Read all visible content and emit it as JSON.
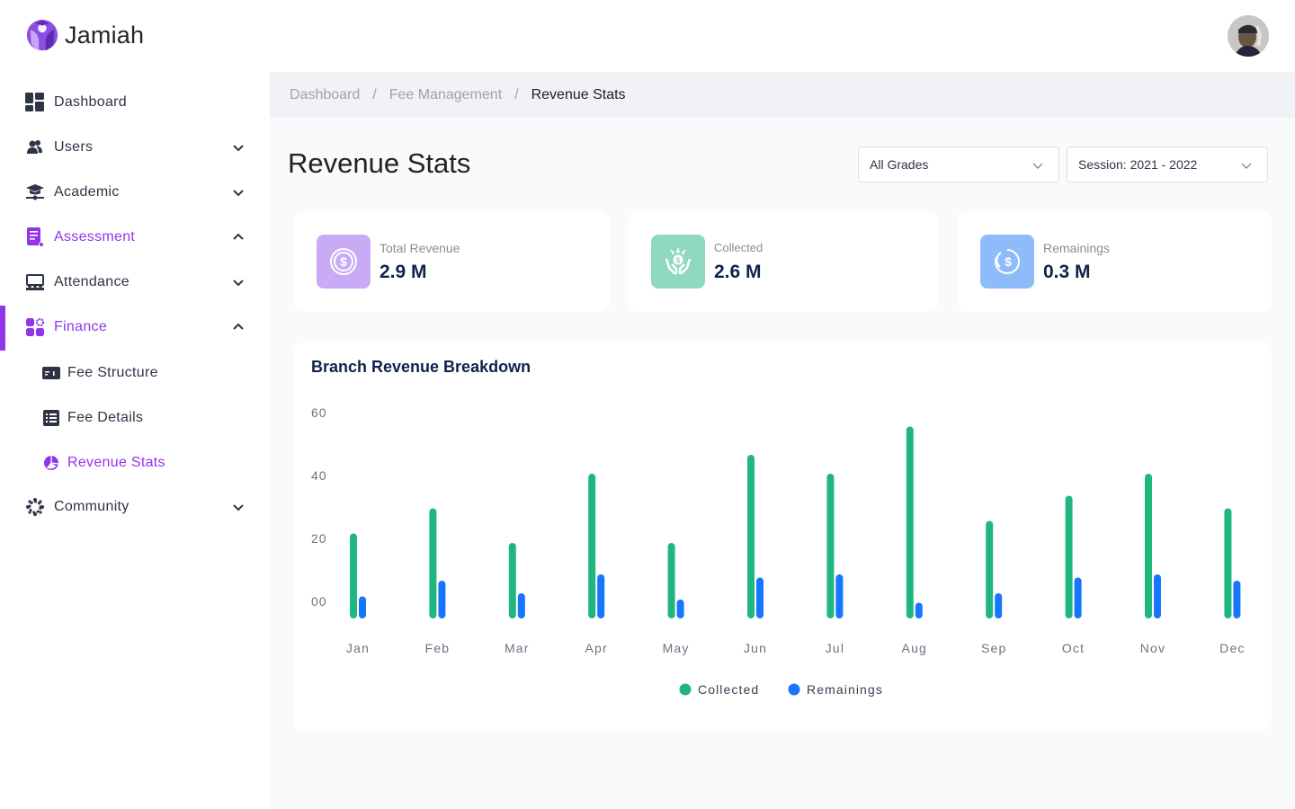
{
  "app": {
    "name": "Jamiah",
    "brand_color": "#9234ea"
  },
  "header": {
    "avatar_alt": "User avatar"
  },
  "sidebar": {
    "items": [
      {
        "label": "Dashboard",
        "icon": "dashboard-icon",
        "expandable": false,
        "active": false
      },
      {
        "label": "Users",
        "icon": "users-icon",
        "expandable": true,
        "expanded": false,
        "active": false
      },
      {
        "label": "Academic",
        "icon": "graduation-cap-icon",
        "expandable": true,
        "expanded": false,
        "active": false
      },
      {
        "label": "Assessment",
        "icon": "document-icon",
        "expandable": true,
        "expanded": true,
        "active": true
      },
      {
        "label": "Attendance",
        "icon": "attendance-icon",
        "expandable": true,
        "expanded": false,
        "active": false
      },
      {
        "label": "Finance",
        "icon": "finance-icon",
        "expandable": true,
        "expanded": true,
        "active": true,
        "children": [
          {
            "label": "Fee Structure",
            "icon": "fee-structure-icon",
            "active": false
          },
          {
            "label": "Fee Details",
            "icon": "list-icon",
            "active": false
          },
          {
            "label": "Revenue Stats",
            "icon": "pie-chart-icon",
            "active": true
          }
        ]
      },
      {
        "label": "Community",
        "icon": "community-icon",
        "expandable": true,
        "expanded": false,
        "active": false
      }
    ]
  },
  "breadcrumb": [
    "Dashboard",
    "Fee Management",
    "Revenue Stats"
  ],
  "page": {
    "title": "Revenue Stats"
  },
  "filters": {
    "grade": {
      "selected": "All Grades"
    },
    "session": {
      "selected": "Session: 2021 - 2022"
    }
  },
  "stats": [
    {
      "label": "Total Revenue",
      "value": "2.9 M",
      "icon": "dollar-coin-icon",
      "color": "#c9aaf5"
    },
    {
      "label": "Collected",
      "value": "2.6 M",
      "icon": "hands-money-icon",
      "color": "#8fd9bf"
    },
    {
      "label": "Remainings",
      "value": "0.3 M",
      "icon": "dollar-refresh-icon",
      "color": "#8ebcfb"
    }
  ],
  "chart_data": {
    "type": "bar",
    "title": "Branch Revenue Breakdown",
    "categories": [
      "Jan",
      "Feb",
      "Mar",
      "Apr",
      "May",
      "Jun",
      "Jul",
      "Aug",
      "Sep",
      "Oct",
      "Nov",
      "Dec"
    ],
    "series": [
      {
        "name": "Collected",
        "color": "#20b77f",
        "values": [
          23,
          31,
          20,
          42,
          20,
          48,
          42,
          57,
          27,
          35,
          42,
          31
        ]
      },
      {
        "name": "Remainings",
        "color": "#1677fe",
        "values": [
          3,
          8,
          4,
          10,
          2,
          9,
          10,
          1,
          4,
          9,
          10,
          8
        ]
      }
    ],
    "ylim": [
      0,
      60
    ],
    "yticks": [
      0,
      20,
      40,
      60
    ],
    "ytick_labels": [
      "00",
      "20",
      "40",
      "60"
    ],
    "xlabel": "",
    "ylabel": "",
    "grid": false,
    "legend": "bottom-center"
  }
}
